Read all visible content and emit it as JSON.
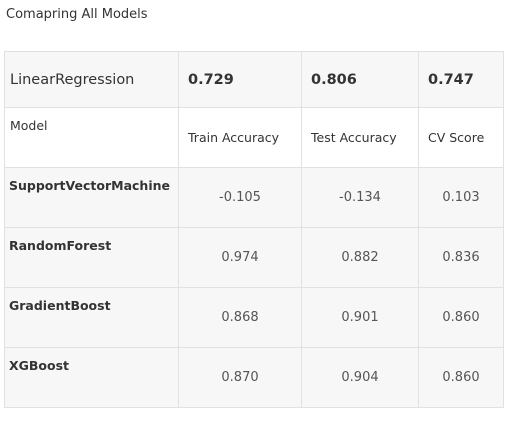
{
  "heading": "Comapring All Models",
  "table": {
    "top_row": {
      "model": "LinearRegression",
      "train": "0.729",
      "test": "0.806",
      "cv": "0.747"
    },
    "columns": {
      "model": "Model",
      "train": "Train Accuracy",
      "test": "Test Accuracy",
      "cv": "CV Score"
    },
    "rows": [
      {
        "model": "SupportVectorMachine",
        "train": "-0.105",
        "test": "-0.134",
        "cv": "0.103"
      },
      {
        "model": "RandomForest",
        "train": "0.974",
        "test": "0.882",
        "cv": "0.836"
      },
      {
        "model": "GradientBoost",
        "train": "0.868",
        "test": "0.901",
        "cv": "0.860"
      },
      {
        "model": "XGBoost",
        "train": "0.870",
        "test": "0.904",
        "cv": "0.860"
      }
    ]
  }
}
